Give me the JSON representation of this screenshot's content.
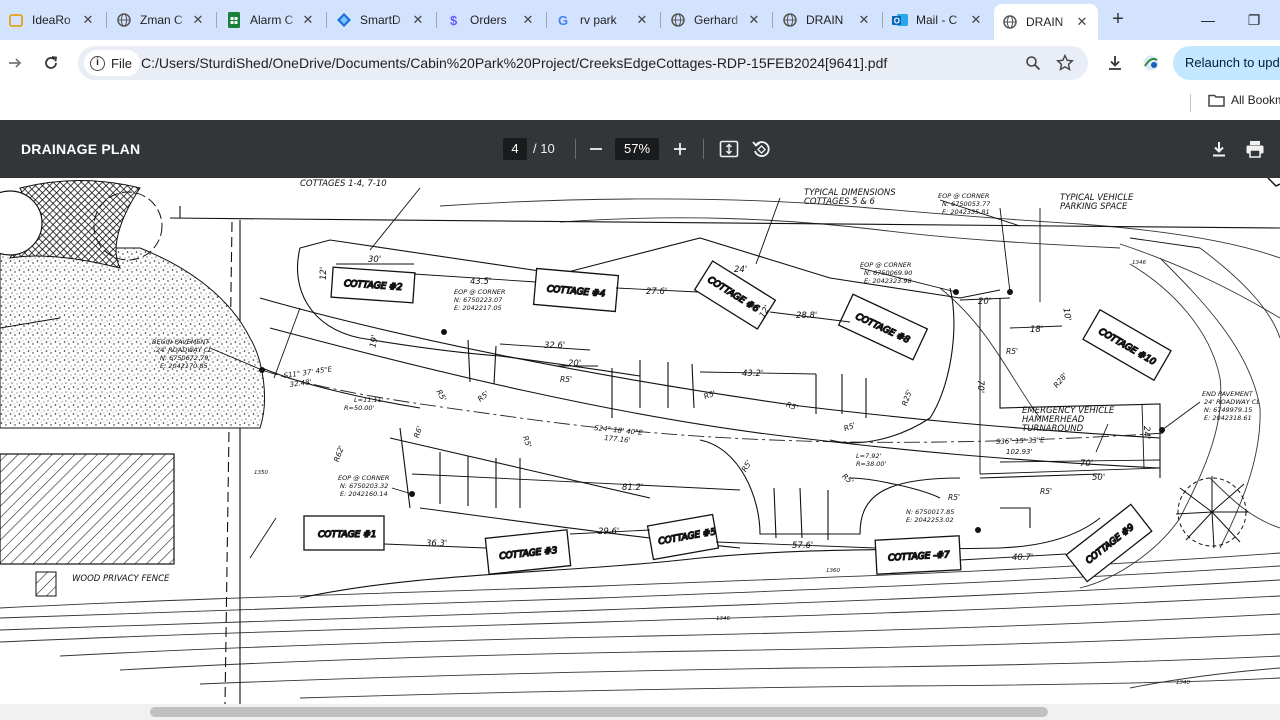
{
  "tabs": [
    {
      "title": "IdeaRo",
      "icon": "idea-icon",
      "active": false
    },
    {
      "title": "Zman C",
      "icon": "globe-icon",
      "active": false
    },
    {
      "title": "Alarm C",
      "icon": "sheets-icon",
      "active": false
    },
    {
      "title": "SmartD",
      "icon": "smartdraw-icon",
      "active": false
    },
    {
      "title": "Orders",
      "icon": "stripe-icon",
      "active": false
    },
    {
      "title": "rv park",
      "icon": "google-icon",
      "active": false
    },
    {
      "title": "Gerhard",
      "icon": "globe-icon",
      "active": false
    },
    {
      "title": "DRAIN",
      "icon": "globe-icon",
      "active": false
    },
    {
      "title": "Mail - C",
      "icon": "outlook-icon",
      "active": false
    },
    {
      "title": "DRAIN",
      "icon": "globe-icon",
      "active": true
    }
  ],
  "toolbar": {
    "chip_label": "File",
    "url": "C:/Users/SturdiShed/OneDrive/Documents/Cabin%20Park%20Project/CreeksEdgeCottages-RDP-15FEB2024[9641].pdf",
    "relaunch_label": "Relaunch to update"
  },
  "bookmarks": {
    "all_label": "All Bookmarks"
  },
  "pdf": {
    "title": "DRAINAGE PLAN",
    "page": "4",
    "total": "/ 10",
    "zoom": "57%"
  },
  "drawing": {
    "cottages": [
      "COTTAGE #1",
      "COTTAGE #2",
      "COTTAGE #3",
      "COTTAGE #4",
      "COTTAGE #5",
      "COTTAGE #6",
      "COTTAGE -#7",
      "COTTAGE #8",
      "COTTAGE #9",
      "COTTAGE #10"
    ],
    "notes": {
      "cottages_1_4": "COTTAGES 1-4, 7-10",
      "typical_dims_1": "TYPICAL DIMENSIONS",
      "typical_dims_2": "COTTAGES 5 & 6",
      "typical_vehicle_1": "TYPICAL VEHICLE",
      "typical_vehicle_2": "PARKING SPACE",
      "emergency_1": "EMERGENCY VEHICLE",
      "emergency_2": "HAMMERHEAD",
      "emergency_3": "TURNAROUND",
      "wood_fence": "WOOD PRIVACY FENCE",
      "begin_pavement_1": "BEGIN PAVEMENT",
      "begin_pavement_2": "24' ROADWAY CL",
      "begin_pavement_3": "N: 6750672.79",
      "begin_pavement_4": "E: 2042170.85",
      "end_pavement_1": "END PAVEMENT",
      "end_pavement_2": "24' ROADWAY CL",
      "end_pavement_3": "N: 6749979.15",
      "end_pavement_4": "E: 2042318.61",
      "eop_a_1": "EOP @ CORNER",
      "eop_a_2": "N: 6750223.07",
      "eop_a_3": "E: 2042217.05",
      "eop_b_1": "EOP @ CORNER",
      "eop_b_2": "N: 6750203.32",
      "eop_b_3": "E: 2042160.14",
      "eop_c_1": "EOP @ CORNER",
      "eop_c_2": "N: 6750069.90",
      "eop_c_3": "E: 2042323.98",
      "eop_d_1": "EOP @ CORNER",
      "eop_d_2": "N: 6750053.77",
      "eop_d_3": "E: 2042335.81",
      "coord_e_1": "N: 6750017.85",
      "coord_e_2": "E: 2042253.02"
    },
    "dimensions": {
      "d30": "30'",
      "d43_5": "43.5'",
      "d27_6": "27.6'",
      "d24": "24'",
      "d28_8": "28.8'",
      "d20a": "20'",
      "d18": "18'",
      "d10": "10'",
      "d32_6": "32.6'",
      "d20b": "20'",
      "d43_2": "43.2'",
      "d81_2": "81.2'",
      "d36_3": "36.3'",
      "d29_6": "29.6'",
      "d57_6": "57.6'",
      "d40_7": "40.7'",
      "d70a": "70'",
      "d70b": "70'",
      "d50": "50'",
      "d24b": "24'",
      "d12": "12'",
      "d12b": "12'",
      "d19": "19'",
      "bearing1": "S11° 37' 45\"E",
      "bearing1_len": "32.48'",
      "bearing2": "S24° 18' 40\"E",
      "bearing2_len": "177.16'",
      "bearing3": "S36° 15' 33\"E",
      "bearing3_len": "102.93'",
      "curve1_l": "L=11.11'",
      "curve1_r": "R=50.00'",
      "curve2_l": "L=7.92'",
      "curve2_r": "R=38.00'",
      "r5": "R5'",
      "r25": "R25'",
      "r28": "R28'",
      "r62": "R62'",
      "r6": "R6'"
    },
    "contours": {
      "c1346a": "1346",
      "c1346b": "1346",
      "c1350": "1350",
      "c1360": "1360",
      "c1340": "1340"
    }
  },
  "colors": {
    "tabstrip": "#d3e3fd",
    "pdfbar": "#323639",
    "relaunch": "#c2e7ff"
  }
}
